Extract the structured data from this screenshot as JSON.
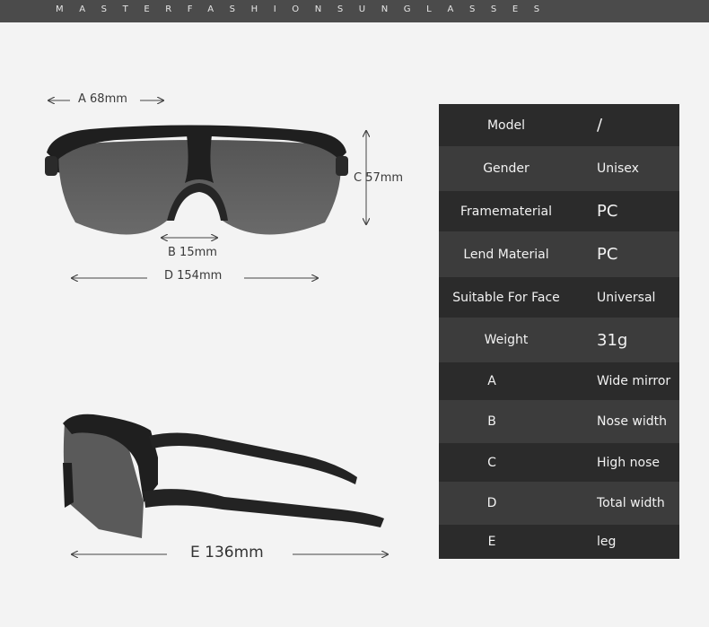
{
  "header": {
    "brand_text": "MASTERFASHIONSUNGLASSES"
  },
  "front_view": {
    "dim_a": "A 68mm",
    "dim_b": "B 15mm",
    "dim_c": "C 57mm",
    "dim_d": "D 154mm"
  },
  "side_view": {
    "dim_e": "E 136mm"
  },
  "specs": [
    {
      "label": "Model",
      "value": "/"
    },
    {
      "label": "Gender",
      "value": "Unisex"
    },
    {
      "label": "Framematerial",
      "value": "PC"
    },
    {
      "label": "Lend Material",
      "value": "PC"
    },
    {
      "label": "Suitable For Face",
      "value": "Universal"
    },
    {
      "label": "Weight",
      "value": "31g"
    },
    {
      "label": "A",
      "value": "Wide mirror"
    },
    {
      "label": "B",
      "value": "Nose width"
    },
    {
      "label": "C",
      "value": "High nose"
    },
    {
      "label": "D",
      "value": "Total width"
    },
    {
      "label": "E",
      "value": "leg"
    }
  ],
  "colors": {
    "header_bg": "#4b4b4b",
    "table_dark": "#2b2b2b",
    "table_light": "#3c3c3c",
    "frame": "#1f1f1f",
    "lens": "#5e5e5e"
  }
}
